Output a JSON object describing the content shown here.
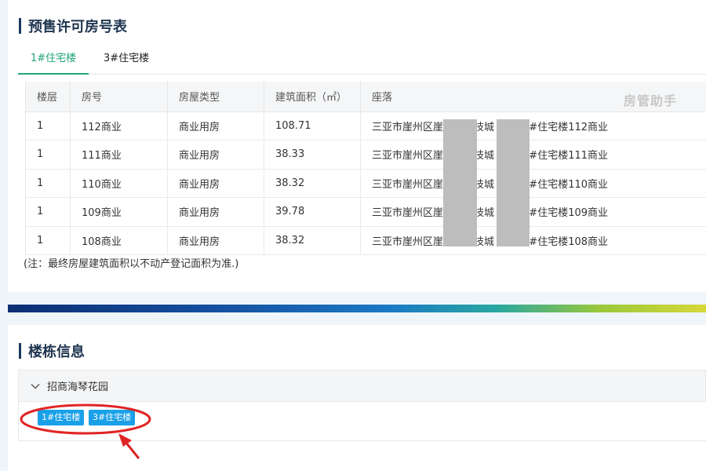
{
  "presale": {
    "title": "预售许可房号表",
    "tabs": [
      "1#住宅楼",
      "3#住宅楼"
    ],
    "active_tab": 0,
    "table": {
      "headers": [
        "楼层",
        "房号",
        "房屋类型",
        "建筑面积（㎡）",
        "座落"
      ],
      "rows": [
        [
          "1",
          "112商业",
          "商业用房",
          "108.71",
          "三亚市崖州区崖",
          "技城",
          "1#住宅楼112商业"
        ],
        [
          "1",
          "111商业",
          "商业用房",
          "38.33",
          "三亚市崖州区崖",
          "技城",
          "1#住宅楼111商业"
        ],
        [
          "1",
          "110商业",
          "商业用房",
          "38.32",
          "三亚市崖州区崖",
          "技城",
          "1#住宅楼110商业"
        ],
        [
          "1",
          "109商业",
          "商业用房",
          "39.78",
          "三亚市崖州区崖",
          "技城",
          "1#住宅楼109商业"
        ],
        [
          "1",
          "108商业",
          "商业用房",
          "38.32",
          "三亚市崖州区崖",
          "技城",
          "1#住宅楼108商业"
        ]
      ]
    },
    "watermark": "房管助手",
    "note": "(注：最终房屋建筑面积以不动产登记面积为准.)"
  },
  "building": {
    "title": "楼栋信息",
    "group_label": "招商海琴花园",
    "buildings": [
      "1#住宅楼",
      "3#住宅楼"
    ]
  },
  "colors": {
    "accent_green": "#21a57f",
    "button_blue": "#1aa0e8",
    "title_dark": "#1f3550",
    "annotation_red": "#e02424"
  }
}
